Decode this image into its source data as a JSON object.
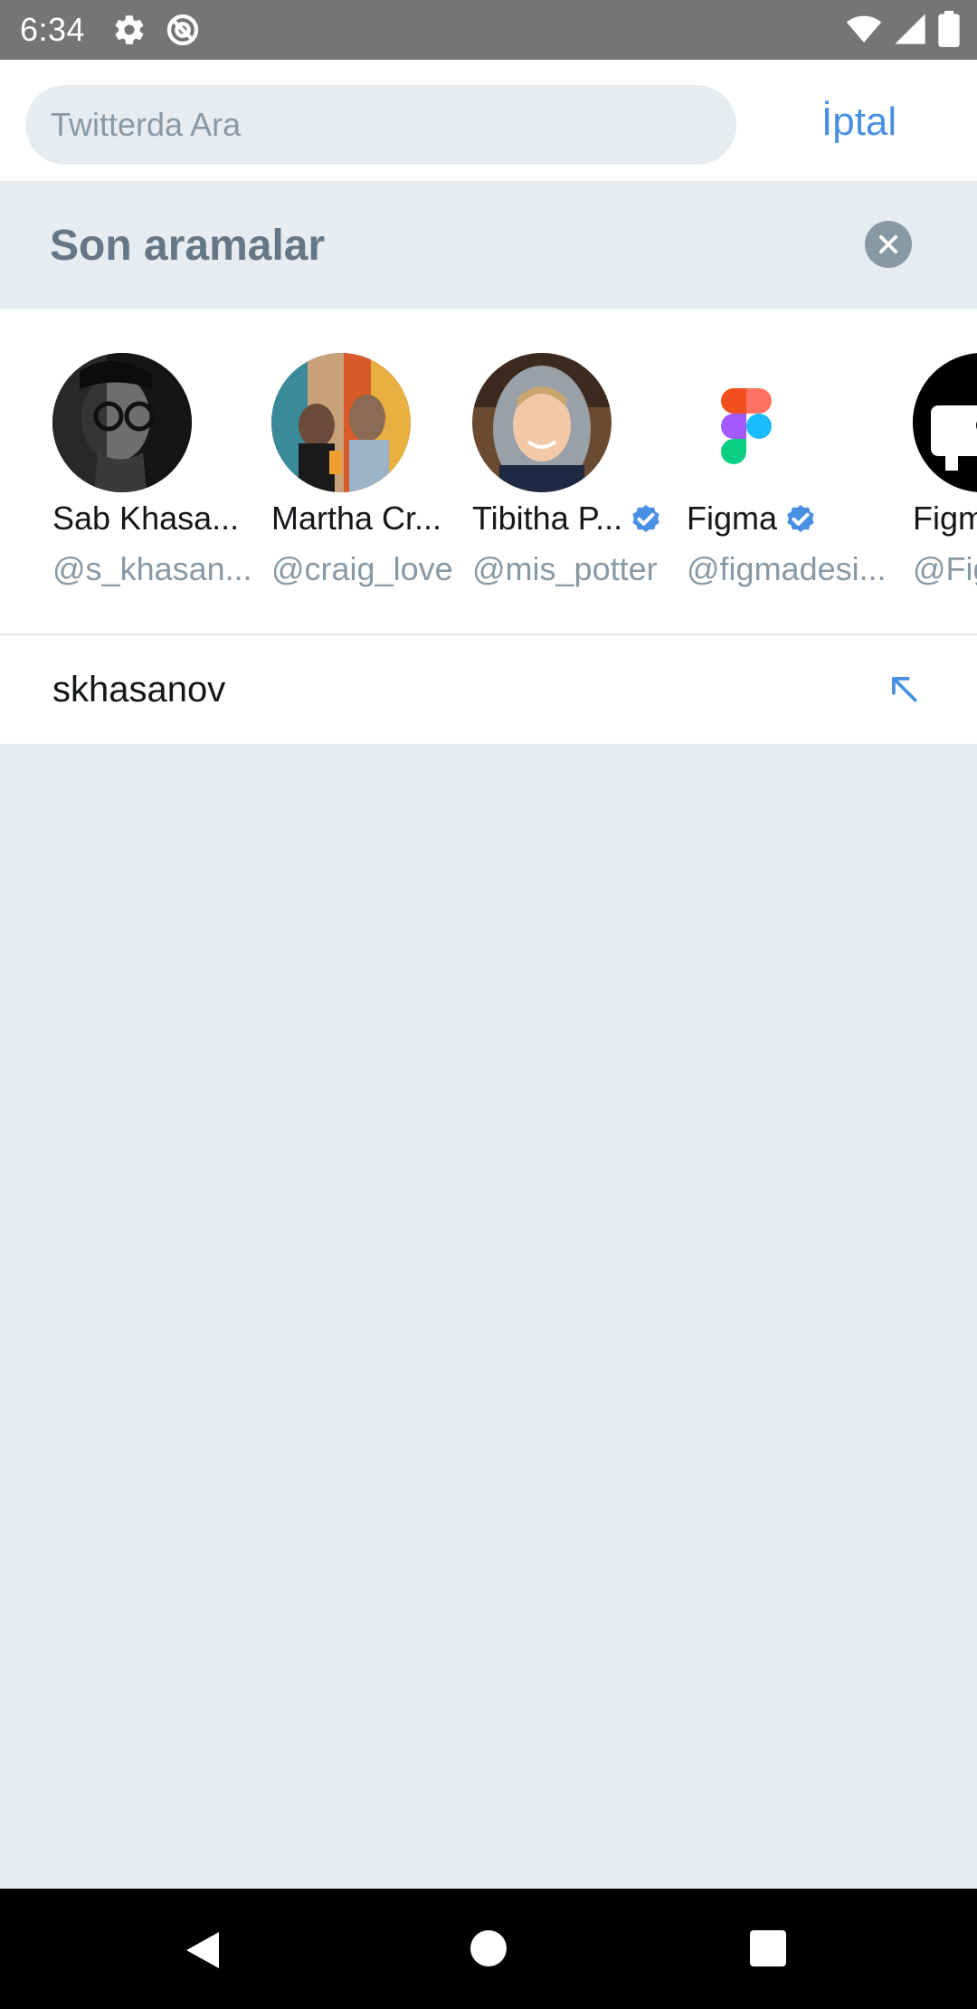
{
  "status_bar": {
    "time": "6:34",
    "left_icons": [
      "gear-icon",
      "no-sim-icon"
    ],
    "right_icons": [
      "wifi-icon",
      "signal-icon",
      "battery-icon"
    ]
  },
  "search": {
    "placeholder": "Twitterda Ara",
    "cancel_label": "İptal"
  },
  "recent_searches": {
    "title": "Son aramalar",
    "clear_icon": "close-icon",
    "users": [
      {
        "name": "Sab Khasa...",
        "handle": "@s_khasan...",
        "verified": false
      },
      {
        "name": "Martha Cr...",
        "handle": "@craig_love",
        "verified": false
      },
      {
        "name": "Tibitha P...",
        "handle": "@mis_potter",
        "verified": true
      },
      {
        "name": "Figma",
        "handle": "@figmadesi...",
        "verified": true
      },
      {
        "name": "Figm",
        "handle": "@Fig",
        "verified": false
      }
    ],
    "queries": [
      {
        "text": "skhasanov",
        "icon": "arrow-up-left-icon"
      }
    ]
  },
  "colors": {
    "accent": "#4A90E2",
    "background": "#E6ECF0",
    "secondary_text": "#8899A6"
  }
}
